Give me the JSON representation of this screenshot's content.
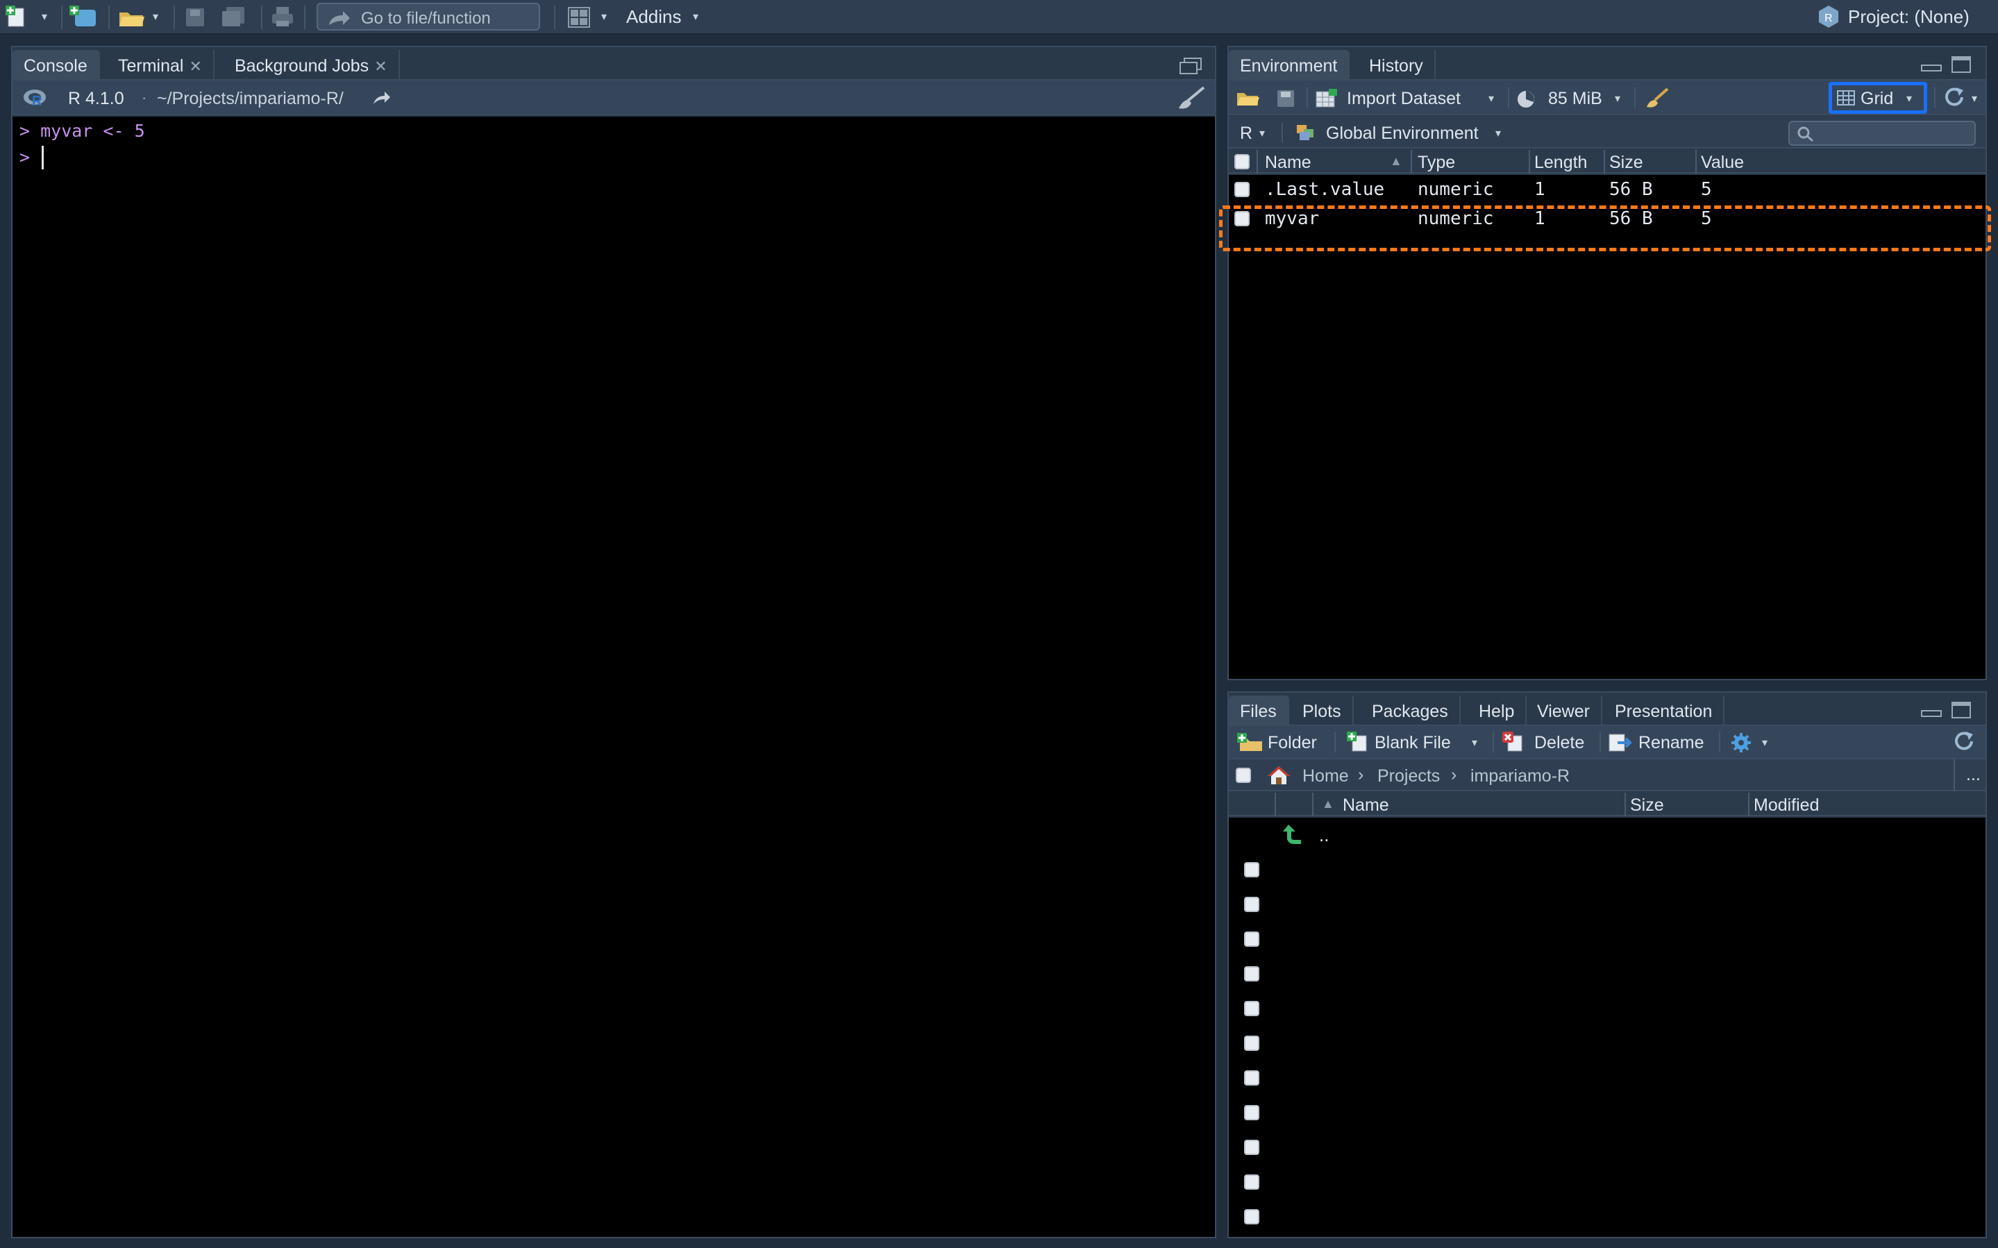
{
  "topbar": {
    "goto_placeholder": "Go to file/function",
    "addins": "Addins",
    "project": "Project: (None)"
  },
  "console_pane": {
    "tabs": [
      {
        "label": "Console"
      },
      {
        "label": "Terminal"
      },
      {
        "label": "Background Jobs"
      }
    ],
    "r_version": "R 4.1.0",
    "path": "~/Projects/impariamo-R/",
    "lines": [
      "> myvar <- 5",
      "> "
    ]
  },
  "env_pane": {
    "tabs": [
      {
        "label": "Environment"
      },
      {
        "label": "History"
      }
    ],
    "import_dataset": "Import Dataset",
    "memory": "85 MiB",
    "view_mode": "Grid",
    "language": "R",
    "scope": "Global Environment",
    "columns": [
      "Name",
      "Type",
      "Length",
      "Size",
      "Value"
    ],
    "rows": [
      {
        "name": ".Last.value",
        "type": "numeric",
        "length": "1",
        "size": "56 B",
        "value": "5"
      },
      {
        "name": "myvar",
        "type": "numeric",
        "length": "1",
        "size": "56 B",
        "value": "5"
      }
    ],
    "highlight_color": "#ff7a1a",
    "grid_highlight_color": "#1a6fff"
  },
  "files_pane": {
    "tabs": [
      {
        "label": "Files"
      },
      {
        "label": "Plots"
      },
      {
        "label": "Packages"
      },
      {
        "label": "Help"
      },
      {
        "label": "Viewer"
      },
      {
        "label": "Presentation"
      }
    ],
    "actions": {
      "folder": "Folder",
      "blank_file": "Blank File",
      "delete": "Delete",
      "rename": "Rename"
    },
    "breadcrumb": [
      "Home",
      "Projects",
      "impariamo-R"
    ],
    "more": "...",
    "columns": {
      "name": "Name",
      "size": "Size",
      "modified": "Modified"
    },
    "parent_dir": ".."
  }
}
